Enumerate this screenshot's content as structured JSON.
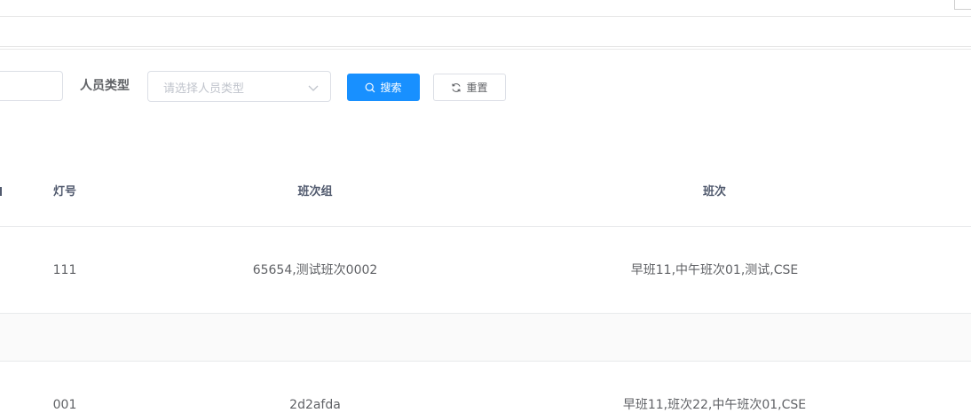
{
  "search_form": {
    "person_type_label": "人员类型",
    "person_type_placeholder": "请选择人员类型",
    "search_button": "搜索",
    "reset_button": "重置"
  },
  "table": {
    "columns": [
      "灯号",
      "班次组",
      "班次"
    ],
    "rows": [
      {
        "light_no": "111",
        "shift_group": "65654,测试班次0002",
        "shift": "早班11,中午班次01,测试,CSE"
      },
      {
        "light_no": "001",
        "shift_group": "2d2afda",
        "shift": "早班11,班次22,中午班次01,CSE"
      }
    ]
  },
  "colors": {
    "primary": "#1890ff",
    "border": "#dcdfe6",
    "placeholder": "#c0c4cc",
    "text": "#606266",
    "header_text": "#515a6e"
  },
  "icons": {
    "search": "search-icon",
    "reset": "refresh-icon",
    "select_arrow": "chevron-down-icon"
  }
}
